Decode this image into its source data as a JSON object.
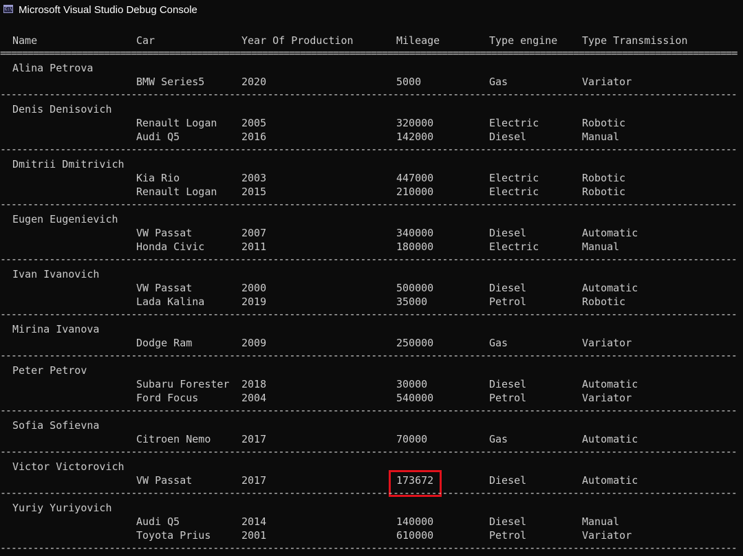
{
  "window": {
    "title": "Microsoft Visual Studio Debug Console",
    "icon": "console-app-icon",
    "icon_glyph": "C:\\"
  },
  "colors": {
    "background": "#0c0c0c",
    "text": "#cccccc",
    "title_text": "#ffffff",
    "highlight": "#e0121c"
  },
  "headers": {
    "name": "Name",
    "car": "Car",
    "year": "Year Of Production",
    "mileage": "Mileage",
    "engine": "Type engine",
    "transmission": "Type Transmission"
  },
  "owners": [
    {
      "name": "Alina Petrova",
      "cars": [
        {
          "car": "BMW Series5",
          "year": "2020",
          "mileage": "5000",
          "engine": "Gas",
          "transmission": "Variator"
        }
      ]
    },
    {
      "name": "Denis Denisovich",
      "cars": [
        {
          "car": "Renault Logan",
          "year": "2005",
          "mileage": "320000",
          "engine": "Electric",
          "transmission": "Robotic"
        },
        {
          "car": "Audi Q5",
          "year": "2016",
          "mileage": "142000",
          "engine": "Diesel",
          "transmission": "Manual"
        }
      ]
    },
    {
      "name": "Dmitrii Dmitrivich",
      "cars": [
        {
          "car": "Kia Rio",
          "year": "2003",
          "mileage": "447000",
          "engine": "Electric",
          "transmission": "Robotic"
        },
        {
          "car": "Renault Logan",
          "year": "2015",
          "mileage": "210000",
          "engine": "Electric",
          "transmission": "Robotic"
        }
      ]
    },
    {
      "name": "Eugen Eugenievich",
      "cars": [
        {
          "car": "VW Passat",
          "year": "2007",
          "mileage": "340000",
          "engine": "Diesel",
          "transmission": "Automatic"
        },
        {
          "car": "Honda Civic",
          "year": "2011",
          "mileage": "180000",
          "engine": "Electric",
          "transmission": "Manual"
        }
      ]
    },
    {
      "name": "Ivan Ivanovich",
      "cars": [
        {
          "car": "VW Passat",
          "year": "2000",
          "mileage": "500000",
          "engine": "Diesel",
          "transmission": "Automatic"
        },
        {
          "car": "Lada Kalina",
          "year": "2019",
          "mileage": "35000",
          "engine": "Petrol",
          "transmission": "Robotic"
        }
      ]
    },
    {
      "name": "Mirina Ivanova",
      "cars": [
        {
          "car": "Dodge Ram",
          "year": "2009",
          "mileage": "250000",
          "engine": "Gas",
          "transmission": "Variator"
        }
      ]
    },
    {
      "name": "Peter Petrov",
      "cars": [
        {
          "car": "Subaru Forester",
          "year": "2018",
          "mileage": "30000",
          "engine": "Diesel",
          "transmission": "Automatic"
        },
        {
          "car": "Ford Focus",
          "year": "2004",
          "mileage": "540000",
          "engine": "Petrol",
          "transmission": "Variator"
        }
      ]
    },
    {
      "name": "Sofia Sofievna",
      "cars": [
        {
          "car": "Citroen Nemo",
          "year": "2017",
          "mileage": "70000",
          "engine": "Gas",
          "transmission": "Automatic"
        }
      ]
    },
    {
      "name": "Victor Victorovich",
      "cars": [
        {
          "car": "VW Passat",
          "year": "2017",
          "mileage": "173672",
          "engine": "Diesel",
          "transmission": "Automatic",
          "highlighted": true
        }
      ]
    },
    {
      "name": "Yuriy Yuriyovich",
      "cars": [
        {
          "car": "Audi Q5",
          "year": "2014",
          "mileage": "140000",
          "engine": "Diesel",
          "transmission": "Manual"
        },
        {
          "car": "Toyota Prius",
          "year": "2001",
          "mileage": "610000",
          "engine": "Petrol",
          "transmission": "Variator"
        }
      ]
    }
  ]
}
